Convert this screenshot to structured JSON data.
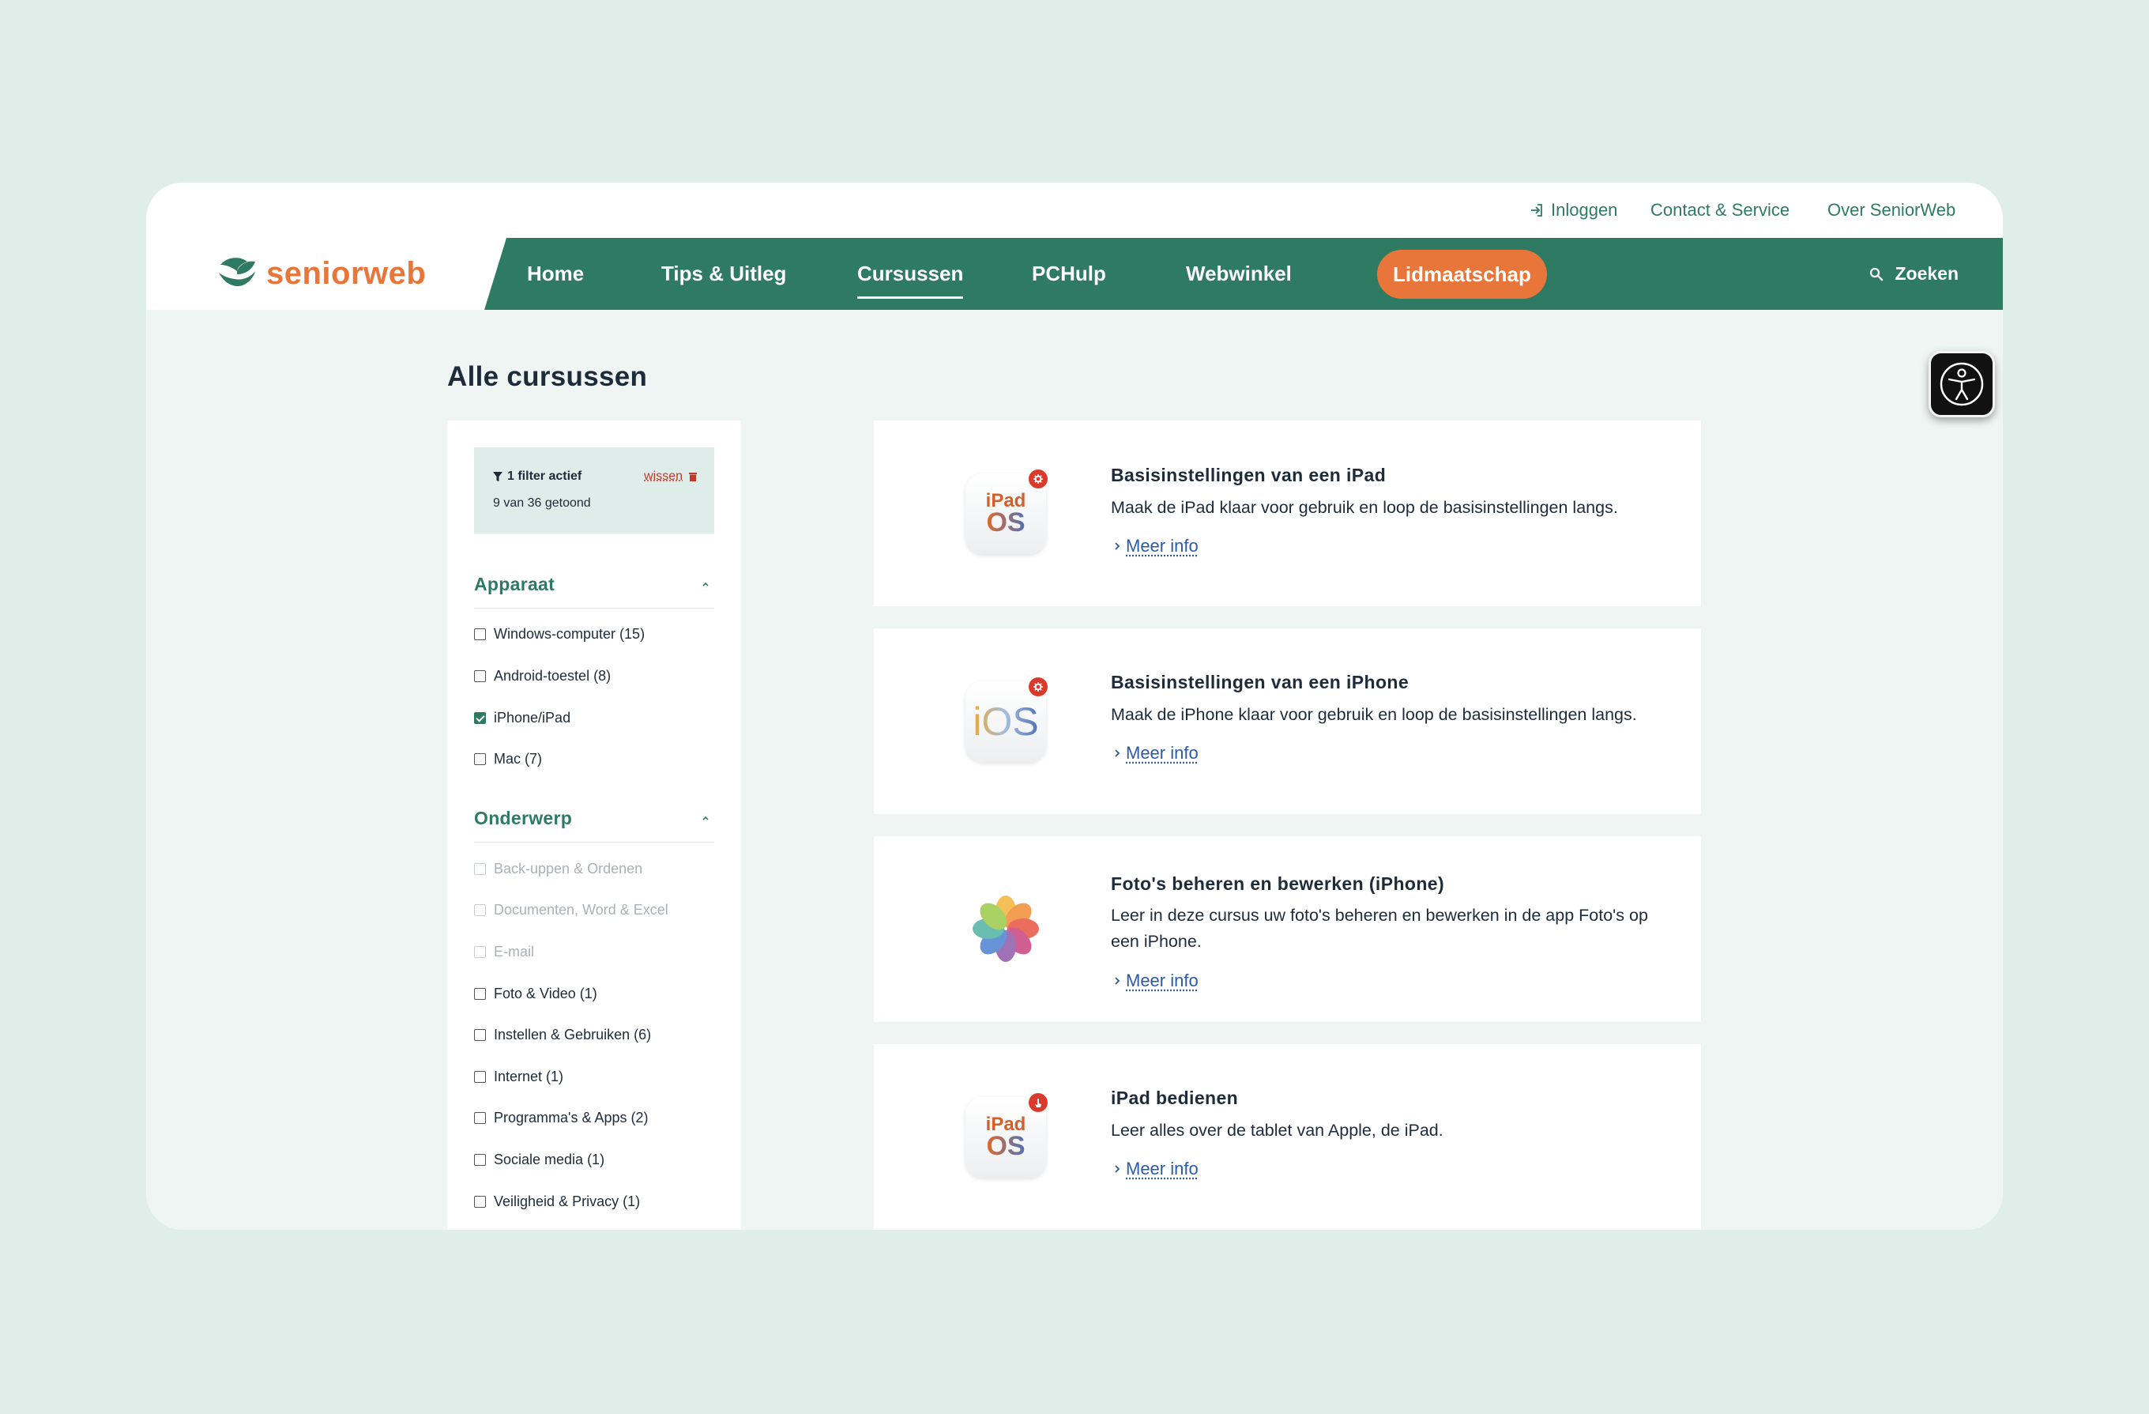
{
  "topbar": {
    "login_label": "Inloggen",
    "contact_label": "Contact & Service",
    "about_label": "Over SeniorWeb"
  },
  "brand": {
    "name": "seniorweb",
    "accent": "#e8763a",
    "primary": "#2f7a63"
  },
  "nav": {
    "items": [
      "Home",
      "Tips & Uitleg",
      "Cursussen",
      "PCHulp",
      "Webwinkel"
    ],
    "active": "Cursussen",
    "cta_label": "Lidmaatschap",
    "search_label": "Zoeken"
  },
  "page": {
    "title": "Alle cursussen"
  },
  "filters": {
    "active_label": "1 filter actief",
    "clear_label": "wissen",
    "count_label": "9 van 36 getoond",
    "groups": [
      {
        "title": "Apparaat",
        "options": [
          {
            "label": "Windows-computer (15)",
            "checked": false,
            "disabled": false
          },
          {
            "label": "Android-toestel (8)",
            "checked": false,
            "disabled": false
          },
          {
            "label": "iPhone/iPad",
            "checked": true,
            "disabled": false
          },
          {
            "label": "Mac (7)",
            "checked": false,
            "disabled": false
          }
        ]
      },
      {
        "title": "Onderwerp",
        "options": [
          {
            "label": "Back-uppen & Ordenen",
            "checked": false,
            "disabled": true
          },
          {
            "label": "Documenten, Word & Excel",
            "checked": false,
            "disabled": true
          },
          {
            "label": "E-mail",
            "checked": false,
            "disabled": true
          },
          {
            "label": "Foto & Video (1)",
            "checked": false,
            "disabled": false
          },
          {
            "label": "Instellen & Gebruiken (6)",
            "checked": false,
            "disabled": false
          },
          {
            "label": "Internet (1)",
            "checked": false,
            "disabled": false
          },
          {
            "label": "Programma's & Apps (2)",
            "checked": false,
            "disabled": false
          },
          {
            "label": "Sociale media (1)",
            "checked": false,
            "disabled": false
          },
          {
            "label": "Veiligheid & Privacy (1)",
            "checked": false,
            "disabled": false
          }
        ]
      }
    ]
  },
  "courses": [
    {
      "title": "Basisinstellingen van een iPad",
      "description": "Maak de iPad klaar voor gebruik en loop de basisinstellingen langs.",
      "more_label": "Meer info",
      "icon": "ipados-icon",
      "icon_top": "iPad",
      "icon_bottom": "OS",
      "badge": "gear-icon"
    },
    {
      "title": "Basisinstellingen van een iPhone",
      "description": "Maak de iPhone klaar voor gebruik en loop de basisinstellingen langs.",
      "more_label": "Meer info",
      "icon": "ios-icon",
      "icon_text": "iOS",
      "badge": "gear-icon"
    },
    {
      "title": "Foto's beheren en bewerken (iPhone)",
      "description": "Leer in deze cursus uw foto's beheren en bewerken in de app Foto's op een iPhone.",
      "more_label": "Meer info",
      "icon": "photos-icon"
    },
    {
      "title": "iPad bedienen",
      "description": "Leer alles over de tablet van Apple, de iPad.",
      "more_label": "Meer info",
      "icon": "ipados-icon",
      "icon_top": "iPad",
      "icon_bottom": "OS",
      "badge": "pointer-icon"
    }
  ]
}
